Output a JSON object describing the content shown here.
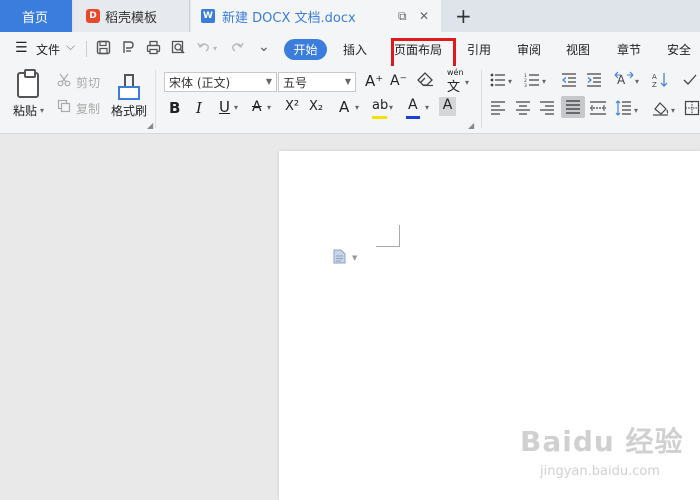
{
  "tabbar": {
    "home_label": "首页",
    "docer_label": "稻壳模板",
    "docer_logo": "D",
    "doc_label": "新建 DOCX 文档.docx",
    "doc_logo": "W",
    "screen_icon": "⧉",
    "close_icon": "✕",
    "new_tab_icon": "+"
  },
  "menu": {
    "hamburger_icon": "☰",
    "file_label": "文件",
    "file_arrow": "⌵",
    "save_icon": "💾",
    "dropdown_icon": "⌄",
    "tabs": [
      "开始",
      "插入",
      "页面布局",
      "引用",
      "审阅",
      "视图",
      "章节",
      "安全"
    ]
  },
  "ribbon": {
    "paste": "粘贴",
    "paste_arrow": "▾",
    "cut": "剪切",
    "copy": "复制",
    "format_painter": "格式刷",
    "font_name": "宋体 (正文)",
    "font_size": "五号",
    "bold": "B",
    "italic": "I",
    "underline": "U",
    "strike": "A",
    "superscript": "X²",
    "subscript": "X₂",
    "font_effect": "A",
    "highlight": "ab",
    "font_color": "A",
    "char_shade": "A",
    "grow_font": "A⁺",
    "shrink_font": "A⁻",
    "pinyin": "wén",
    "pinyin_char": "文"
  },
  "colors": {
    "accent": "#3b7ddd",
    "highlight_box": "#e0191e",
    "highlight_yellow": "#f5e100",
    "font_red": "#e0191e",
    "font_blue": "#1c3fd6"
  },
  "watermark": {
    "main": "Baidu 经验",
    "sub": "jingyan.baidu.com"
  }
}
